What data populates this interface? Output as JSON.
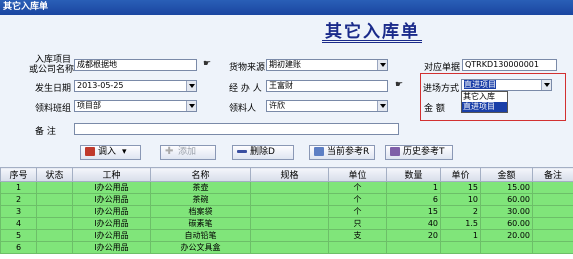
{
  "window": {
    "title": "其它入库单"
  },
  "form": {
    "heading": "其它入库单",
    "fields": {
      "org_label_1": "入库项目",
      "org_label_2": "或公司名称",
      "org_value": "成都根据地",
      "source_label": "货物来源",
      "source_value": "期初建账",
      "ref_label": "对应单据",
      "ref_value": "QTRKD130000001",
      "date_label": "发生日期",
      "date_value": "2013-05-25",
      "handler_label": "经 办 人",
      "handler_value": "王富财",
      "mode_label": "进场方式",
      "mode_value": "直进项目",
      "team_label": "领料班组",
      "team_value": "项目部",
      "receiver_label": "领料人",
      "receiver_value": "许欣",
      "amount_label": "金    额",
      "remark_label": "备    注"
    },
    "mode_options": [
      "其它入库",
      "直进项目"
    ],
    "mode_selected_index": 1
  },
  "toolbar": {
    "import_label": "调入",
    "add_label": "添加",
    "delete_label": "删除D",
    "current_ref_label": "当前参考R",
    "history_ref_label": "历史参考T"
  },
  "grid": {
    "headers": [
      "序号",
      "状态",
      "工种",
      "名称",
      "规格",
      "单位",
      "数量",
      "单价",
      "金额",
      "备注"
    ],
    "rows": [
      [
        "1",
        "",
        "I办公用品",
        "茶壶",
        "",
        "个",
        "1",
        "15",
        "15.00",
        ""
      ],
      [
        "2",
        "",
        "I办公用品",
        "茶碗",
        "",
        "个",
        "6",
        "10",
        "60.00",
        ""
      ],
      [
        "3",
        "",
        "I办公用品",
        "档案袋",
        "",
        "个",
        "15",
        "2",
        "30.00",
        ""
      ],
      [
        "4",
        "",
        "I办公用品",
        "碳素笔",
        "",
        "只",
        "40",
        "1.5",
        "60.00",
        ""
      ],
      [
        "5",
        "",
        "I办公用品",
        "自动铅笔",
        "",
        "支",
        "20",
        "1",
        "20.00",
        ""
      ],
      [
        "6",
        "",
        "I办公用品",
        "办公文具盒",
        "",
        "",
        "",
        "",
        "",
        ""
      ]
    ]
  },
  "colors": {
    "title_bar": "#1a45a0",
    "row_bg": "#80e57a",
    "heading": "#1a2a8a",
    "highlight_border": "#d23030"
  }
}
